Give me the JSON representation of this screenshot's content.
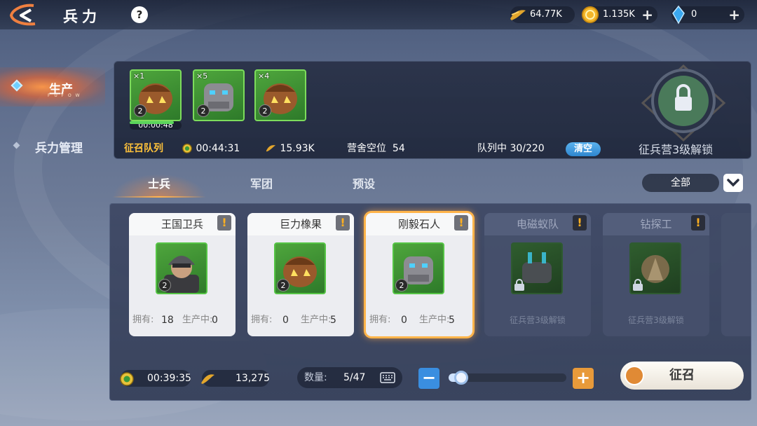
{
  "header": {
    "title": "兵力",
    "help": "?"
  },
  "resources": [
    {
      "icon": "food-icon",
      "value": "64.77K",
      "has_plus": false
    },
    {
      "icon": "gold-coin-icon",
      "value": "1.135K",
      "has_plus": true
    },
    {
      "icon": "blue-crystal-icon",
      "value": "0",
      "has_plus": true
    }
  ],
  "sidebar": {
    "items": [
      {
        "label": "生产",
        "sub": "F U F O W",
        "active": true
      },
      {
        "label": "兵力管理",
        "active": false
      }
    ]
  },
  "queue": {
    "units": [
      {
        "mult": "×1",
        "level": "2",
        "kind": "acorn"
      },
      {
        "mult": "×5",
        "level": "2",
        "kind": "golem"
      },
      {
        "mult": "×4",
        "level": "2",
        "kind": "acorn"
      }
    ],
    "current_timer": "00:00:48",
    "current_progress": 0.85,
    "label": "征召队列",
    "total_time": "00:44:31",
    "food_cost": "15.93K",
    "barracks_label": "营舍空位",
    "barracks_value": "54",
    "in_queue": "队列中 30/220",
    "clear": "清空",
    "locked_text": "征兵营3级解锁"
  },
  "tabs": [
    "士兵",
    "军团",
    "预设"
  ],
  "filter": "全部",
  "cards": [
    {
      "name": "王国卫兵",
      "level": "2",
      "own_label": "拥有:",
      "own": "18",
      "prod_label": "生产中:",
      "prod": "0",
      "locked": false,
      "selected": false,
      "kind": "guard"
    },
    {
      "name": "巨力橡果",
      "level": "2",
      "own_label": "拥有:",
      "own": "0",
      "prod_label": "生产中:",
      "prod": "5",
      "locked": false,
      "selected": false,
      "kind": "acorn"
    },
    {
      "name": "刚毅石人",
      "level": "2",
      "own_label": "拥有:",
      "own": "0",
      "prod_label": "生产中:",
      "prod": "5",
      "locked": false,
      "selected": true,
      "kind": "golem"
    },
    {
      "name": "电磁蚁队",
      "unlock": "征兵营3级解锁",
      "locked": true,
      "kind": "ant"
    },
    {
      "name": "钻探工",
      "unlock": "征兵营3级解锁",
      "locked": true,
      "kind": "drill"
    }
  ],
  "bottom": {
    "time": "00:39:35",
    "food": "13,275",
    "qty_label": "数量:",
    "qty_value": "5/47",
    "slider_fraction": 0.106,
    "recruit": "征召"
  }
}
